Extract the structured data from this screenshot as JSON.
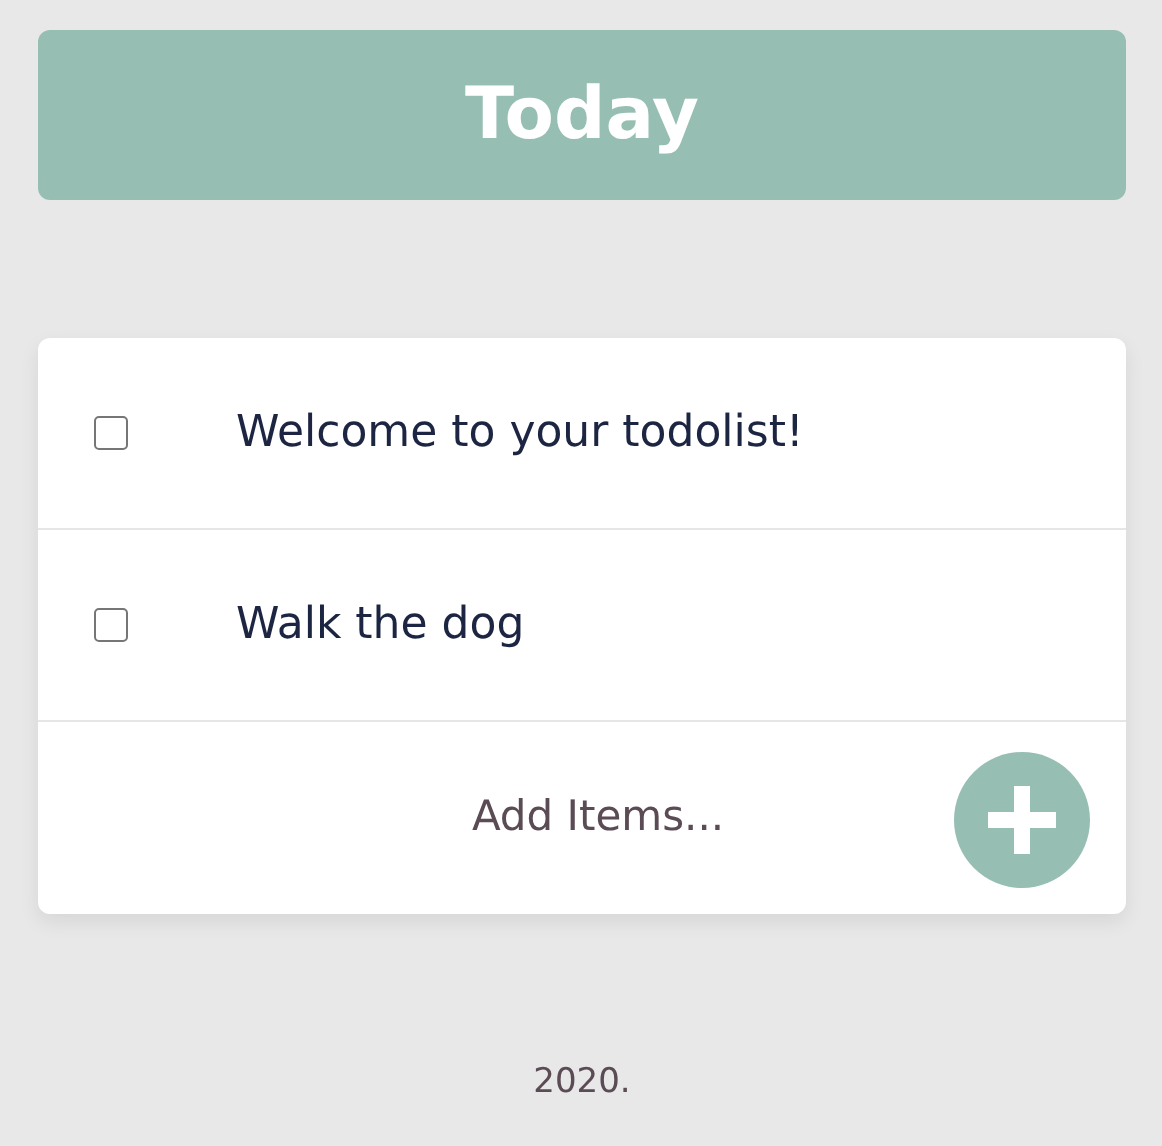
{
  "header": {
    "title": "Today"
  },
  "items": [
    {
      "text": "Welcome to your todolist!",
      "checked": false
    },
    {
      "text": "Walk the dog",
      "checked": false
    }
  ],
  "new_item": {
    "placeholder": "Add Items..."
  },
  "footer": {
    "text": "2020."
  }
}
